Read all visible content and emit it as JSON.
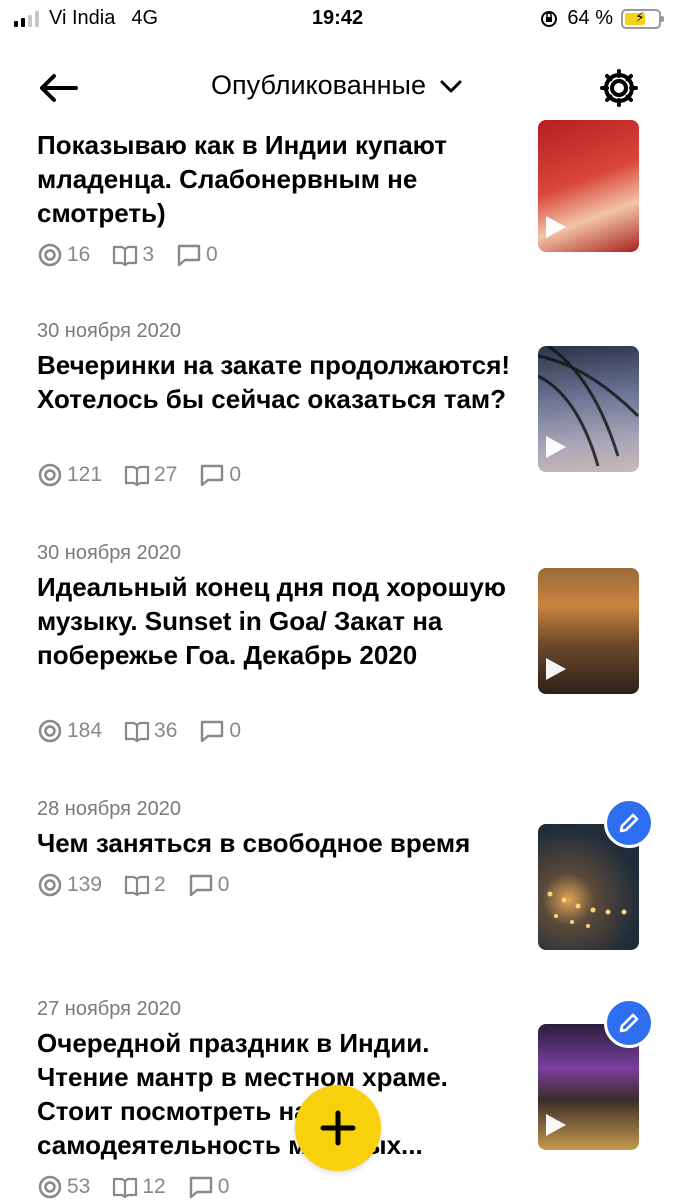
{
  "status_bar": {
    "carrier": "Vi India",
    "network": "4G",
    "time": "19:42",
    "battery": "64 %",
    "battery_level": 0.64
  },
  "header": {
    "back_icon": "arrow-left-icon",
    "title": "Опубликованные",
    "dropdown_icon": "chevron-down-icon",
    "settings_icon": "gear-icon"
  },
  "posts": [
    {
      "date": "",
      "title": "Показываю как в Индии купают младенца. Слабонервным не смотреть)",
      "views": "16",
      "reads": "3",
      "comments": "0",
      "thumb_colors": [
        "#b51f1f",
        "#d9463a",
        "#f2c4a8"
      ]
    },
    {
      "date": "30 ноября 2020",
      "title": "Вечеринки на закате продолжаются! Хотелось бы сейчас оказаться там?",
      "views": "121",
      "reads": "27",
      "comments": "0",
      "thumb_colors": [
        "#4b5a78",
        "#8e93ab",
        "#c0b5b6"
      ]
    },
    {
      "date": "30 ноября 2020",
      "title": "Идеальный конец дня под хорошую музыку. Sunset in Goa/ Закат на побережье Гоа. Декабрь 2020",
      "views": "184",
      "reads": "36",
      "comments": "0",
      "thumb_colors": [
        "#8a5a2d",
        "#c8843f",
        "#3d2a1f"
      ]
    },
    {
      "date": "28 ноября 2020",
      "title": "Чем заняться в свободное время",
      "views": "139",
      "reads": "2",
      "comments": "0",
      "thumb_colors": [
        "#1f2c3a",
        "#3b4a4a",
        "#e0a455"
      ]
    },
    {
      "date": "27 ноября 2020",
      "title": "Очередной праздник в Индии. Чтение мантр в местном храме. Стоит посмотреть на самодеятельность местных...",
      "views": "53",
      "reads": "12",
      "comments": "0",
      "thumb_colors": [
        "#2a1d3d",
        "#7a3fa0",
        "#c59a4a"
      ]
    }
  ],
  "fab": {
    "icon": "plus-icon",
    "color": "#f8d00e"
  },
  "colors": {
    "accent_blue": "#2d6ff0",
    "muted": "#888888"
  }
}
